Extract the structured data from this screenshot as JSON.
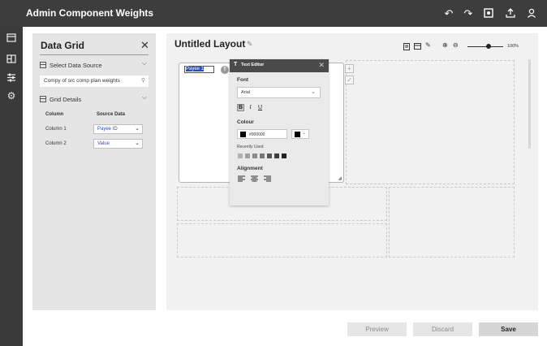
{
  "app": {
    "title": "Admin Component Weights"
  },
  "topbar": {
    "icons": [
      "undo-icon",
      "redo-icon",
      "preview-icon",
      "upload-icon",
      "user-icon"
    ]
  },
  "rail": {
    "icons": [
      "layout-icon",
      "components-icon",
      "sliders-icon",
      "settings-icon"
    ]
  },
  "panel": {
    "title": "Data Grid",
    "select_source_label": "Select Data Source",
    "source_value": "Compy of src comp plan weights",
    "grid_details_label": "Grid Details",
    "column_header": "Column",
    "source_header": "Source Data",
    "rows": [
      {
        "column": "Column 1",
        "source": "Payee ID"
      },
      {
        "column": "Column 2",
        "source": "Value"
      }
    ]
  },
  "canvas": {
    "title": "Untitled Layout",
    "zoom_level": "100%",
    "zoom_fraction": 0.6,
    "cell_label": "Payee 1",
    "cell_icon_letter": "T"
  },
  "text_editor": {
    "title": "Text Editor",
    "font_label": "Font",
    "font_value": "Arial",
    "bold": "B",
    "italic": "I",
    "underline": "U",
    "colour_label": "Colour",
    "colour_value": "#000000",
    "colour_hex": "#000000",
    "recently_used_label": "Recently Used",
    "recent_colors": [
      "#b3b3b3",
      "#a0a0a0",
      "#8c8c8c",
      "#777777",
      "#555555",
      "#3d3d3d",
      "#222222"
    ],
    "alignment_label": "Alignment"
  },
  "footer": {
    "preview": "Preview",
    "discard": "Discard",
    "save": "Save"
  }
}
